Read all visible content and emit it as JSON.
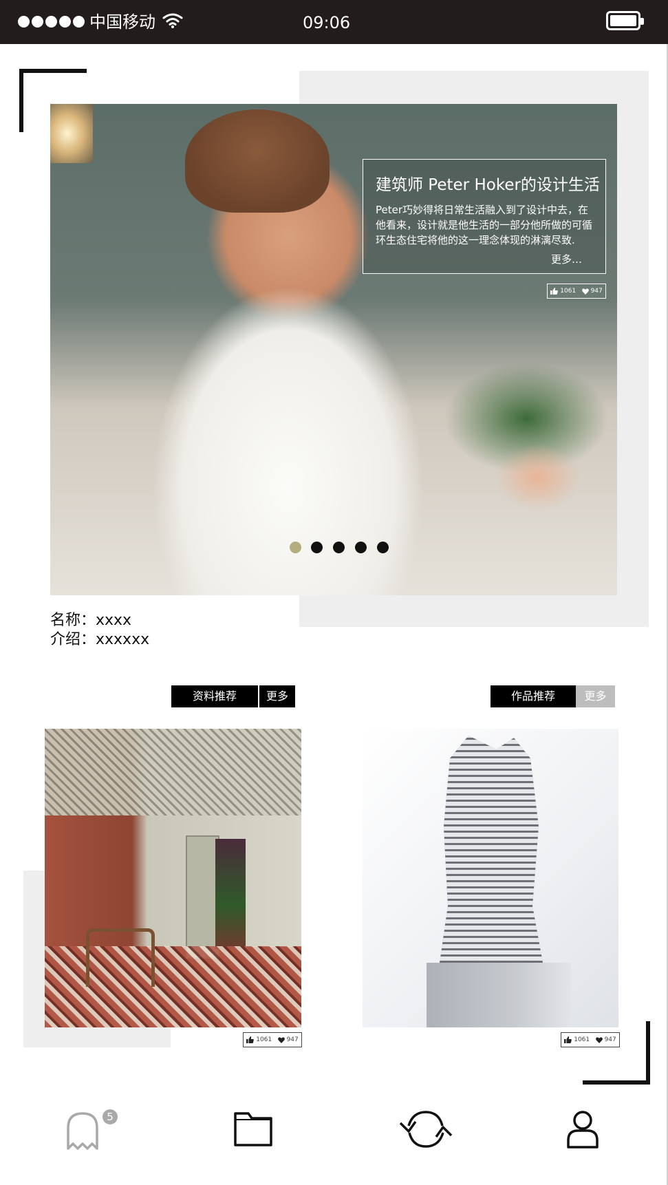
{
  "status_bar": {
    "carrier": "中国移动",
    "time": "09:06",
    "signal_dots": 5
  },
  "hero": {
    "title": "建筑师 Peter Hoker的设计生活",
    "description": "Peter巧妙得将日常生活融入到了设计中去，在他看来，设计就是他生活的一部分他所做的可循环生态住宅将他的这一理念体现的淋漓尽致.",
    "more": "更多…",
    "likes": "1061",
    "favorites": "947",
    "pager_total": 5,
    "pager_active": 1
  },
  "info": {
    "name_line": "名称：xxxx",
    "intro_line": "介绍：xxxxxx"
  },
  "sections": {
    "materials": {
      "label": "资料推荐",
      "more": "更多"
    },
    "works": {
      "label": "作品推荐",
      "more": "更多"
    }
  },
  "cards": [
    {
      "likes": "1061",
      "favorites": "947"
    },
    {
      "likes": "1061",
      "favorites": "947"
    }
  ],
  "tab_bar": {
    "items": [
      "ghost-icon",
      "folder-icon",
      "refresh-icon",
      "user-icon"
    ],
    "badge": "5"
  },
  "colors": {
    "status_bar_bg": "#231c1c",
    "pager_active": "#b4ad80",
    "more_button_grey": "#bdbdbd",
    "panel_grey": "#eeeeee"
  }
}
